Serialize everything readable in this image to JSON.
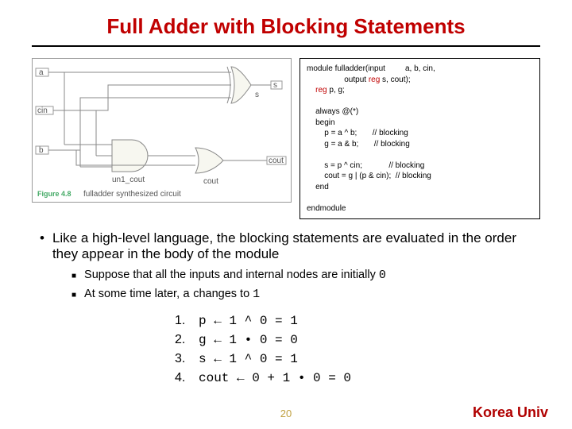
{
  "title": "Full Adder with Blocking Statements",
  "diagram": {
    "ports": {
      "a": "a",
      "b": "b",
      "cin": "cin",
      "s": "s",
      "cout": "cout"
    },
    "gates": {
      "g1": "s",
      "g2": "un1_cout",
      "g3": "cout"
    },
    "caption_label": "Figure 4.8",
    "caption_text": "fulladder synthesized circuit"
  },
  "code": {
    "l1a": "module fulladder(input         a, b, cin,",
    "l1b": "                 output ",
    "l1b_kw": "reg",
    "l1b2": " s, cout);",
    "l2_kw": "    reg",
    "l2": " p, g;",
    "l3": "    always @(*)",
    "l4": "    begin",
    "l5": "        p = a ^ b;       // blocking",
    "l6": "        g = a & b;       // blocking",
    "l7": "        s = p ^ cin;            // blocking",
    "l8": "        cout = g | (p & cin);  // blocking",
    "l9": "    end",
    "l10": "endmodule"
  },
  "bullet_main": "Like a high-level language, the blocking statements are evaluated in the order they appear in the body of the module",
  "sub1a": "Suppose that all the inputs and internal nodes are initially ",
  "sub1b": "0",
  "sub2a": "At some time later, ",
  "sub2b": "a",
  "sub2c": " changes to ",
  "sub2d": "1",
  "steps": {
    "s1n": "1.",
    "s1": "p    ←  1 ^ 0  = 1",
    "s2n": "2.",
    "s2": "g    ←  1 • 0  = 0",
    "s3n": "3.",
    "s3": "s    ←  1 ^ 0  = 1",
    "s4n": "4.",
    "s4": "cout ← 0 + 1 •  0  = 0"
  },
  "pagenum": "20",
  "brand": "Korea Univ"
}
